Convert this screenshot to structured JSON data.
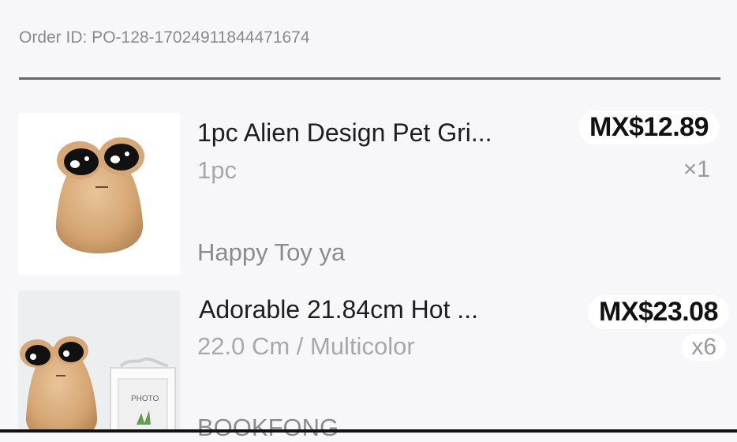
{
  "order": {
    "id_text": "Order ID: PO-128-17024911844471674"
  },
  "items": [
    {
      "title": "1pc Alien Design Pet Gri...",
      "variant": "1pc",
      "shop": "Happy Toy ya",
      "price": "MX$12.89",
      "quantity": "×1",
      "image_icon": "plush-toy-image"
    },
    {
      "title": "Adorable 21.84cm Hot ...",
      "variant": "22.0 Cm / Multicolor",
      "shop": "BOOKFONG",
      "price": "MX$23.08",
      "quantity": "x6",
      "image_icon": "plush-toy-with-frame-image",
      "frame_text": "PHOTO"
    }
  ]
}
